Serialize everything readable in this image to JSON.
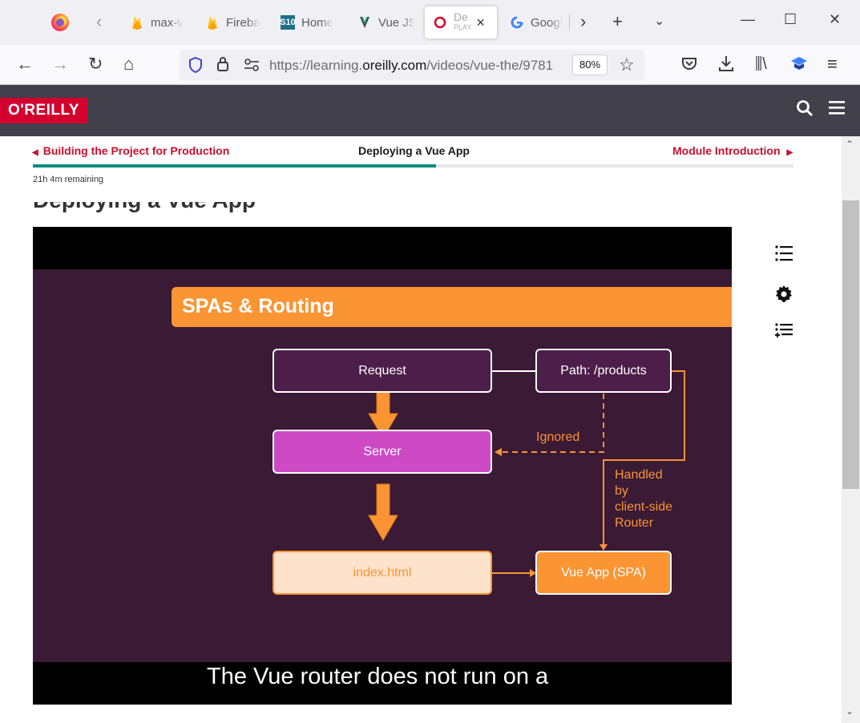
{
  "browser": {
    "tabs": [
      {
        "title": "max-v",
        "icon": "firebase-icon"
      },
      {
        "title": "Fireba",
        "icon": "firebase-icon"
      },
      {
        "title": "Home",
        "icon": "s10-icon",
        "icon_text": "S10"
      },
      {
        "title": "Vue JS",
        "icon": "vue-icon"
      },
      {
        "title": "De",
        "subtitle": "PLAY",
        "icon": "oreilly-icon",
        "active": true
      },
      {
        "title": "Googl",
        "icon": "google-icon"
      }
    ],
    "url_prefix": "https://learning.",
    "url_domain": "oreilly.com",
    "url_suffix": "/videos/vue-the/9781",
    "zoom": "80%"
  },
  "site": {
    "logo": "O'REILLY",
    "prev_link": "Building the Project for Production",
    "current": "Deploying a Vue App",
    "next_link": "Module Introduction",
    "progress": 0.53,
    "remaining": "21h 4m remaining",
    "page_title": "Deploying a Vue App"
  },
  "slide": {
    "title": "SPAs & Routing",
    "request": "Request",
    "path": "Path: /products",
    "server": "Server",
    "ignored": "Ignored",
    "handled": [
      "Handled",
      "by",
      "client-side",
      "Router"
    ],
    "index": "index.html",
    "vueapp": "Vue App (SPA)",
    "caption": "The Vue router does not run on a"
  },
  "colors": {
    "brand_red": "#d3002d",
    "header_bg": "#41404b",
    "progress": "#0a8a82",
    "slide_bg": "#3a1a35",
    "accent_orange": "#fb9433"
  }
}
